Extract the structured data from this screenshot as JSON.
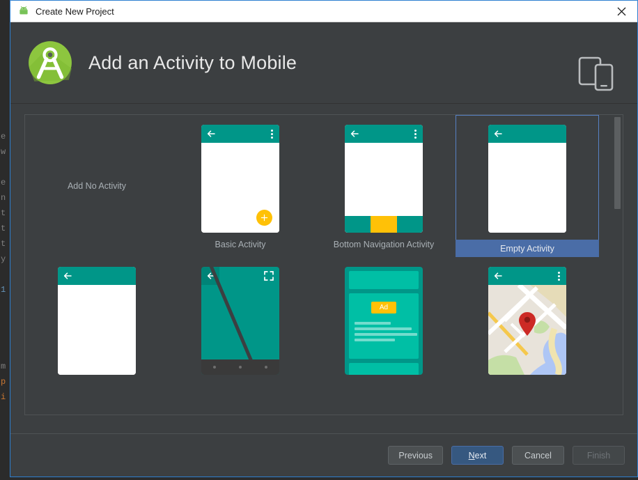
{
  "window": {
    "title": "Create New Project",
    "app_icon": "android-robot-icon",
    "close_label": "✕"
  },
  "header": {
    "title": "Add an Activity to Mobile",
    "logo": "android-studio-logo",
    "form_factor_icon": "tablet-phone-icon"
  },
  "gallery": {
    "selected": "Empty Activity",
    "templates": [
      {
        "label": "Add No Activity",
        "thumb": "none",
        "selected": false
      },
      {
        "label": "Basic Activity",
        "thumb": "basic",
        "selected": false
      },
      {
        "label": "Bottom Navigation Activity",
        "thumb": "bottomnav",
        "selected": false
      },
      {
        "label": "Empty Activity",
        "thumb": "empty",
        "selected": true
      },
      {
        "label": "",
        "thumb": "fullscreen-plain",
        "selected": false
      },
      {
        "label": "",
        "thumb": "fullscreen",
        "selected": false
      },
      {
        "label": "",
        "thumb": "ad",
        "selected": false
      },
      {
        "label": "",
        "thumb": "maps",
        "selected": false
      }
    ],
    "ad_badge_text": "Ad"
  },
  "footer": {
    "previous_label": "Previous",
    "next_label_prefix": "",
    "next_mnemonic": "N",
    "next_label_suffix": "ext",
    "cancel_label": "Cancel",
    "finish_label": "Finish"
  },
  "ide_background": {
    "gutter_chars": [
      "e",
      "w",
      "",
      "e",
      "n",
      "t",
      "t",
      "t",
      "y",
      "",
      "1",
      "",
      "",
      "",
      "",
      "m",
      "p",
      "i"
    ]
  },
  "colors": {
    "dialog_bg": "#3c3f41",
    "dialog_border": "#2d7fd0",
    "titlebar_bg": "#ffffff",
    "accent_teal": "#009688",
    "accent_amber": "#ffc107",
    "selection_blue": "#4a6da7",
    "selection_outline": "#5781c4",
    "text_primary": "#e8e8e8",
    "text_secondary": "#a9b0b5",
    "android_green": "#78c257"
  }
}
